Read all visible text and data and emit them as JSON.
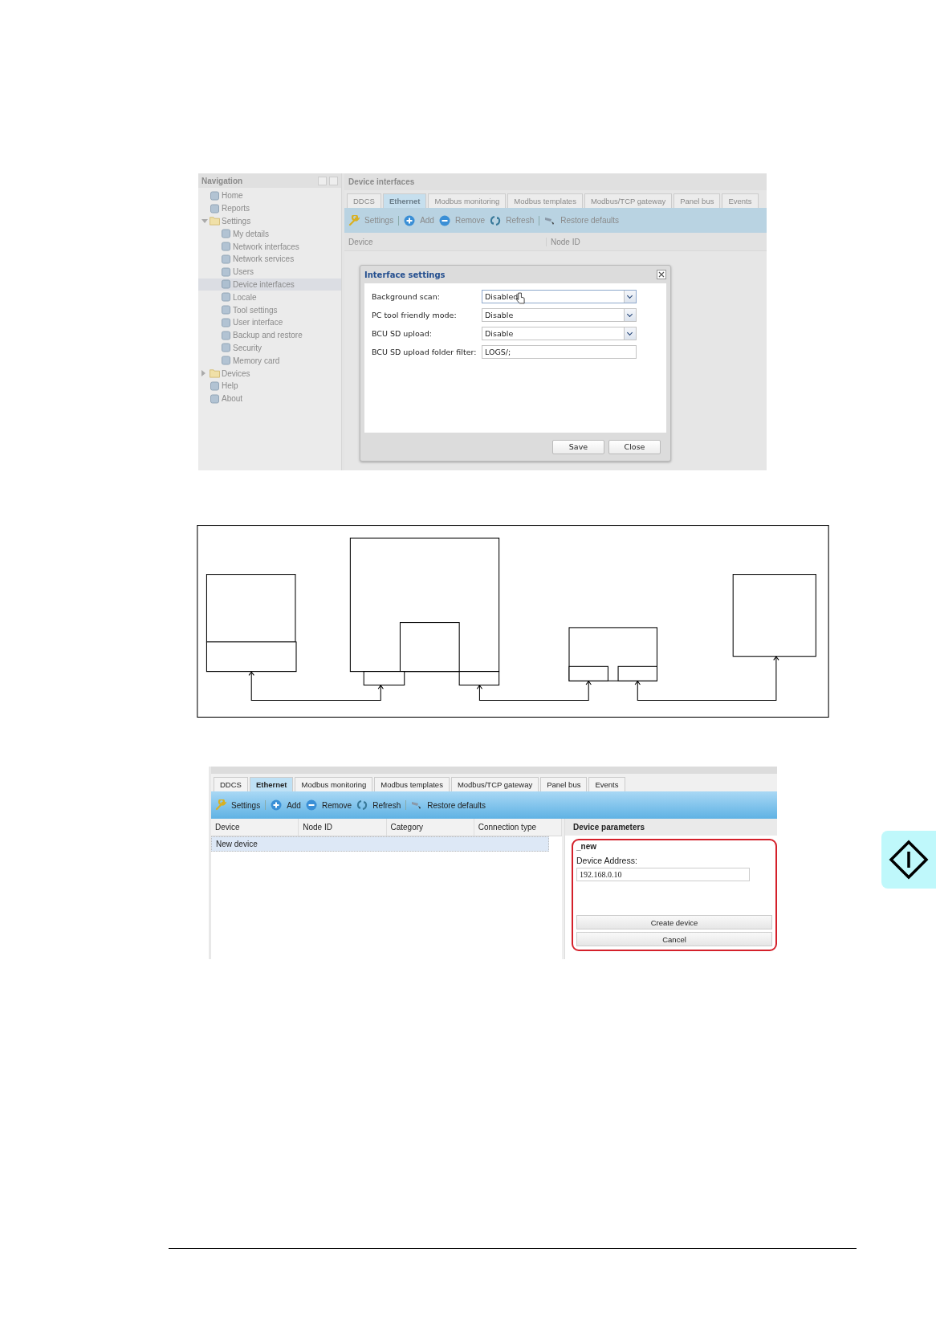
{
  "screenshot_1": {
    "navigation": {
      "title": "Navigation",
      "items": [
        {
          "label": "Home",
          "selected": false
        },
        {
          "label": "Reports",
          "selected": false
        },
        {
          "label": "Settings",
          "selected": false,
          "expanded": true,
          "children": [
            {
              "label": "My details",
              "selected": false
            },
            {
              "label": "Network interfaces",
              "selected": false
            },
            {
              "label": "Network services",
              "selected": false
            },
            {
              "label": "Users",
              "selected": false
            },
            {
              "label": "Device interfaces",
              "selected": true
            },
            {
              "label": "Locale",
              "selected": false
            },
            {
              "label": "Tool settings",
              "selected": false
            },
            {
              "label": "User interface",
              "selected": false
            },
            {
              "label": "Backup and restore",
              "selected": false
            },
            {
              "label": "Security",
              "selected": false
            },
            {
              "label": "Memory card",
              "selected": false
            }
          ]
        },
        {
          "label": "Devices",
          "selected": false,
          "expanded": false
        },
        {
          "label": "Help",
          "selected": false
        },
        {
          "label": "About",
          "selected": false
        }
      ]
    },
    "panel_title": "Device interfaces",
    "tabs": [
      {
        "label": "DDCS",
        "selected": false
      },
      {
        "label": "Ethernet",
        "selected": true
      },
      {
        "label": "Modbus monitoring",
        "selected": false
      },
      {
        "label": "Modbus templates",
        "selected": false
      },
      {
        "label": "Modbus/TCP gateway",
        "selected": false
      },
      {
        "label": "Panel bus",
        "selected": false
      },
      {
        "label": "Events",
        "selected": false
      }
    ],
    "toolbar": [
      {
        "kind": "settings",
        "label": "Settings"
      },
      {
        "kind": "add",
        "label": "Add",
        "separator_before": true
      },
      {
        "kind": "remove",
        "label": "Remove"
      },
      {
        "kind": "refresh",
        "label": "Refresh"
      },
      {
        "kind": "restore",
        "label": "Restore defaults",
        "separator_before": true
      }
    ],
    "columns": [
      "Device",
      "Node ID"
    ],
    "dialog": {
      "title": "Interface settings",
      "fields": [
        {
          "kind": "select",
          "label": "Background scan:",
          "value": "Disabled"
        },
        {
          "kind": "select",
          "label": "PC tool friendly mode:",
          "value": "Disable"
        },
        {
          "kind": "select",
          "label": "BCU SD upload:",
          "value": "Disable"
        },
        {
          "kind": "text",
          "label": "BCU SD upload folder filter:",
          "value": "LOGS/;"
        }
      ],
      "buttons": [
        "Save",
        "Close"
      ]
    }
  },
  "screenshot_2": {
    "tabs": [
      {
        "label": "DDCS",
        "selected": false
      },
      {
        "label": "Ethernet",
        "selected": true
      },
      {
        "label": "Modbus monitoring",
        "selected": false
      },
      {
        "label": "Modbus templates",
        "selected": false
      },
      {
        "label": "Modbus/TCP gateway",
        "selected": false
      },
      {
        "label": "Panel bus",
        "selected": false
      },
      {
        "label": "Events",
        "selected": false
      }
    ],
    "toolbar": [
      {
        "kind": "settings",
        "label": "Settings"
      },
      {
        "kind": "add",
        "label": "Add",
        "separator_before": true
      },
      {
        "kind": "remove",
        "label": "Remove"
      },
      {
        "kind": "refresh",
        "label": "Refresh"
      },
      {
        "kind": "restore",
        "label": "Restore defaults",
        "separator_before": true
      }
    ],
    "columns": [
      "Device",
      "Node ID",
      "Category",
      "Connection type"
    ],
    "rows": [
      {
        "cells": [
          "New device"
        ],
        "selected": true
      }
    ],
    "device_parameters": {
      "title": "Device parameters",
      "name": "_new",
      "field_label": "Device Address:",
      "field_value": "192.168.0.10",
      "buttons": [
        "Create device",
        "Cancel"
      ]
    }
  }
}
